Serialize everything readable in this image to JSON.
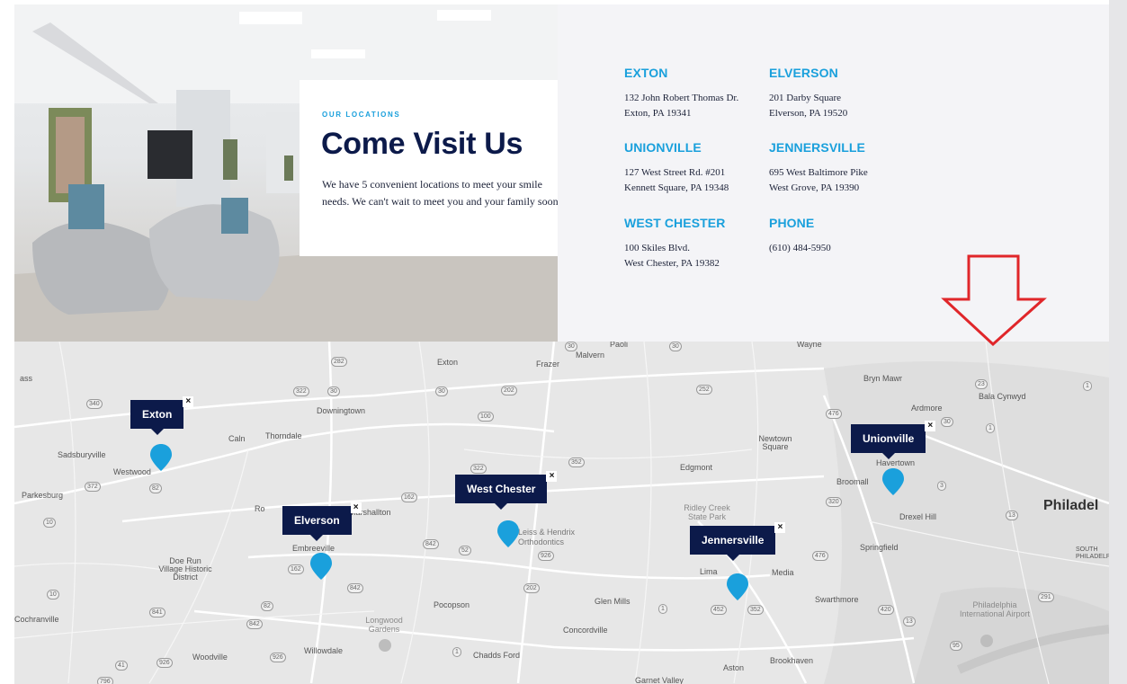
{
  "hero": {
    "eyebrow": "OUR LOCATIONS",
    "title": "Come Visit Us",
    "description": "We have 5 convenient locations to meet your smile needs. We can't wait to meet you and your family soon!"
  },
  "locations": [
    {
      "name": "EXTON",
      "line1": "132 John Robert Thomas Dr.",
      "line2": "Exton, PA 19341"
    },
    {
      "name": "ELVERSON",
      "line1": "201 Darby Square",
      "line2": "Elverson, PA 19520"
    },
    {
      "name": "UNIONVILLE",
      "line1": "127 West Street Rd. #201",
      "line2": "Kennett Square, PA 19348"
    },
    {
      "name": "JENNERSVILLE",
      "line1": "695 West Baltimore Pike",
      "line2": "West Grove, PA 19390"
    },
    {
      "name": "WEST CHESTER",
      "line1": "100 Skiles Blvd.",
      "line2": "West Chester, PA 19382"
    },
    {
      "name": "PHONE",
      "line1": "(610) 484-5950",
      "line2": ""
    }
  ],
  "map": {
    "markers": [
      {
        "label": "Exton",
        "close": "×"
      },
      {
        "label": "Elverson",
        "close": "×"
      },
      {
        "label": "West Chester",
        "close": "×"
      },
      {
        "label": "Jennersville",
        "close": "×"
      },
      {
        "label": "Unionville",
        "close": "×"
      }
    ],
    "places": [
      "Exton",
      "Frazer",
      "Malvern",
      "Paoli",
      "Wayne",
      "Bryn Mawr",
      "Ardmore",
      "Bala Cynwyd",
      "Downingtown",
      "Thorndale",
      "Caln",
      "Sadsburyville",
      "Westwood",
      "Parkesburg",
      "Newtown Square",
      "Edgmont",
      "Broomall",
      "Havertown",
      "Drexel Hill",
      "Philadel",
      "Ridley Creek State Park",
      "Leiss & Hendrix Orthodontics",
      "Marshallton",
      "Embreeville",
      "Doe Run Village Historic District",
      "Springfield",
      "Lima",
      "Media",
      "Glen Mills",
      "Pocopson",
      "Swarthmore",
      "Longwood Gardens",
      "Concordville",
      "Philadelphia International Airport",
      "Cochranville",
      "Willowdale",
      "Chadds Ford",
      "Woodville",
      "Aston",
      "Brookhaven",
      "Garnet Valley",
      "SOUTH PHILADELPHIA",
      "ass",
      "Ro"
    ],
    "shields": [
      "282",
      "322",
      "30",
      "30",
      "202",
      "340",
      "252",
      "100",
      "476",
      "30",
      "23",
      "1",
      "372",
      "82",
      "352",
      "322",
      "162",
      "10",
      "842",
      "52",
      "926",
      "320",
      "3",
      "13",
      "1",
      "162",
      "842",
      "202",
      "476",
      "10",
      "82",
      "841",
      "842",
      "1",
      "452",
      "352",
      "420",
      "13",
      "291",
      "95",
      "41",
      "926",
      "926",
      "1",
      "796",
      "30",
      "30"
    ]
  },
  "colors": {
    "navy": "#0c1a4a",
    "accent": "#1aa0dc",
    "pin": "#1aa0dc",
    "arrow": "#e0262a"
  }
}
